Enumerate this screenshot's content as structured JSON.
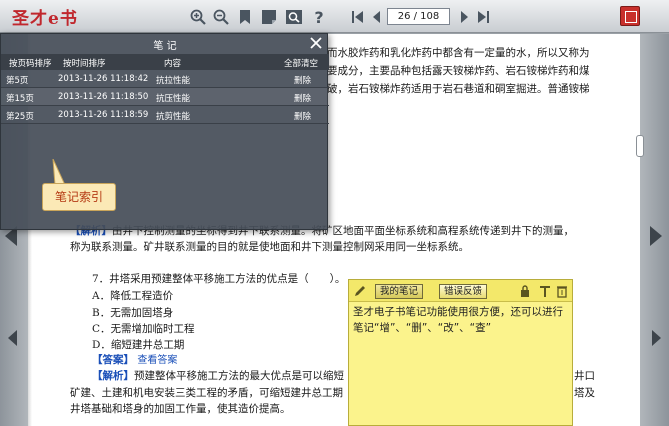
{
  "app": {
    "logo_text": "圣才e书"
  },
  "toolbar": {
    "page_indicator": "26 / 108",
    "icons": [
      "zoom-in-icon",
      "zoom-out-icon",
      "bookmark-icon",
      "notes-icon",
      "search-icon",
      "help-icon",
      "first-page-icon",
      "prev-page-icon",
      "next-page-icon",
      "last-page-icon",
      "exit-icon"
    ]
  },
  "notes_panel": {
    "title": "笔 记",
    "columns": [
      "按页码排序",
      "按时间排序",
      "内容",
      "全部清空"
    ],
    "rows": [
      {
        "page": "第5页",
        "time": "2013-11-26 11:18:42",
        "content": "抗拉性能",
        "action": "删除"
      },
      {
        "page": "第15页",
        "time": "2013-11-26 11:18:50",
        "content": "抗压性能",
        "action": "删除"
      },
      {
        "page": "第25页",
        "time": "2013-11-26 11:18:59",
        "content": "抗剪性能",
        "action": "删除"
      }
    ],
    "callout": "笔记索引"
  },
  "document": {
    "top_lines": [
      "而水胶炸药和乳化炸药中都含有一定量的水，所以又称为",
      "要成分，主要品种包括露天铵梯炸药、岩石铵梯炸药和煤",
      "破，岩石铵梯炸药适用于岩石巷道和硐室掘进。普通铵梯"
    ],
    "analysis_label": "【解析】",
    "analysis_line1": "由井下控制测量的坐标得到井下联系测量。将矿区地面平面坐标系统和高程系统传递到井下的测量，",
    "analysis_line2": "称为联系测量。矿井联系测量的目的就是使地面和井下测量控制网采用同一坐标系统。",
    "question": "7．井塔采用预建整体平移施工方法的优点是（　　）。",
    "options": [
      "A．降低工程造价",
      "B．无需加固塔身",
      "C．无需增加临时工程",
      "D．缩短建井总工期"
    ],
    "answer_label": "【答案】",
    "answer_link": "查看答案",
    "analysis2_label": "【解析】",
    "analysis2_line1": "预建整体平移施工方法的最大优点是可以缩短",
    "analysis2_line1_right": "井口",
    "analysis2_line2": "矿建、土建和机电安装三类工程的矛盾，可缩短建井总工期",
    "analysis2_line2_right": "塔及",
    "analysis2_line3": "井塔基础和塔身的加固工作量，使其造价提高。"
  },
  "sticky_note": {
    "tab_my_notes": "我的笔记",
    "tab_feedback": "错误反馈",
    "text": "圣才电子书笔记功能使用很方便，还可以进行笔记“增”、“删”、“改”、“查”"
  }
}
